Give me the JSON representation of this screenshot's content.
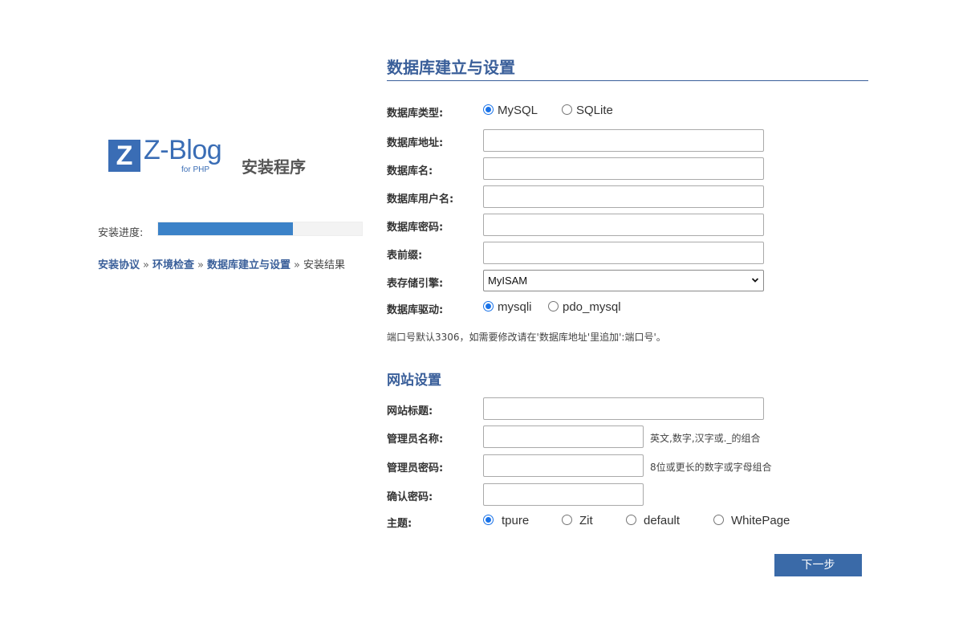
{
  "logo": {
    "letter": "Z",
    "brand": "Z-Blog",
    "subtitle": "for PHP",
    "title": "安装程序"
  },
  "progress": {
    "label": "安装进度:",
    "value_percent": 66
  },
  "steps": {
    "items": [
      "安装协议",
      "环境检查",
      "数据库建立与设置",
      "安装结果"
    ],
    "separator": "»",
    "current_index": 3
  },
  "database": {
    "heading": "数据库建立与设置",
    "type": {
      "label": "数据库类型:",
      "options": [
        "MySQL",
        "SQLite"
      ],
      "selected": "MySQL"
    },
    "host": {
      "label": "数据库地址:",
      "value": ""
    },
    "name": {
      "label": "数据库名:",
      "value": ""
    },
    "user": {
      "label": "数据库用户名:",
      "value": ""
    },
    "password": {
      "label": "数据库密码:",
      "value": ""
    },
    "prefix": {
      "label": "表前缀:",
      "value": ""
    },
    "engine": {
      "label": "表存储引擎:",
      "selected": "MyISAM"
    },
    "driver": {
      "label": "数据库驱动:",
      "options": [
        "mysqli",
        "pdo_mysql"
      ],
      "selected": "mysqli"
    },
    "note": "端口号默认3306，如需要修改请在'数据库地址'里追加':端口号'。"
  },
  "site": {
    "heading": "网站设置",
    "title": {
      "label": "网站标题:",
      "value": ""
    },
    "admin_name": {
      "label": "管理员名称:",
      "value": "",
      "hint": "英文,数字,汉字或._的组合"
    },
    "admin_password": {
      "label": "管理员密码:",
      "value": "",
      "hint": "8位或更长的数字或字母组合"
    },
    "confirm_password": {
      "label": "确认密码:",
      "value": ""
    },
    "theme": {
      "label": "主题:",
      "options": [
        "tpure",
        "Zit",
        "default",
        "WhitePage"
      ],
      "selected": "tpure"
    }
  },
  "next_button": "下一步",
  "colors": {
    "accent": "#3a5f9a",
    "progress": "#3b82c8",
    "button": "#3a6aa8",
    "radio": "#1a73e8"
  }
}
